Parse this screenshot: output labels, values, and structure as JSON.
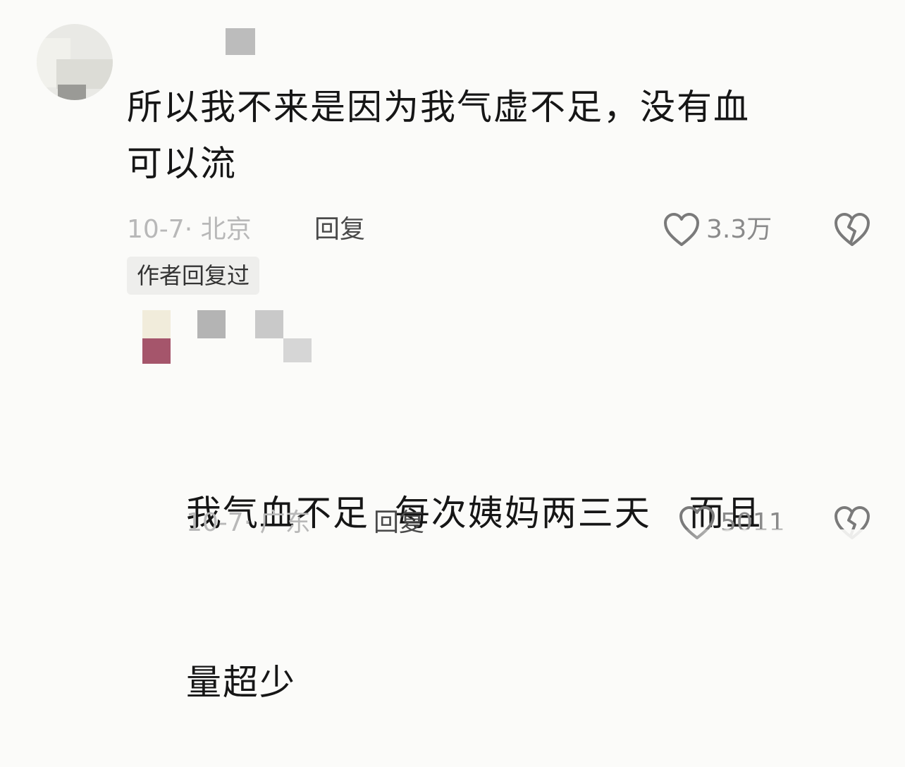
{
  "comment_main": {
    "text_line1": "所以我不来是因为我气虚不足，没有血",
    "text_line2": "可以流",
    "date_location": "10-7· 北京",
    "reply_label": "回复",
    "likes": "3.3万",
    "author_badge": "作者回复过"
  },
  "comment_reply": {
    "text_line1": "我气血不足  每次姨妈两三天   而且",
    "text_line2": "量超少",
    "date_location": "10-7· 广东",
    "reply_label": "回复",
    "likes": "5011"
  },
  "icons": {
    "like": "heart-outline-icon",
    "dislike": "broken-heart-icon"
  },
  "colors": {
    "background": "#fbfbf9",
    "text": "#161616",
    "meta": "#b8b8b8",
    "reply": "#4a4a4a",
    "badge_bg": "#eeeeec",
    "icon": "#7a7a7a"
  }
}
